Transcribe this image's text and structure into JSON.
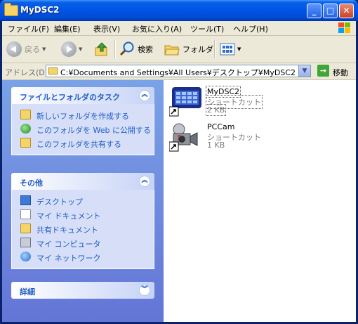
{
  "window": {
    "title": "MyDSC2"
  },
  "menu": [
    "ファイル(F)",
    "編集(E)",
    "表示(V)",
    "お気に入り(A)",
    "ツール(T)",
    "ヘルプ(H)"
  ],
  "toolbar": {
    "back_label": "戻る",
    "search_label": "検索",
    "folders_label": "フォルダ"
  },
  "address": {
    "label": "アドレス(D)",
    "path": "C:¥Documents and Settings¥All Users¥デスクトップ¥MyDSC2",
    "go_label": "移動"
  },
  "tasks_panel": {
    "title": "ファイルとフォルダのタスク",
    "items": [
      {
        "label": "新しいフォルダを作成する",
        "icon": "new-folder-icon"
      },
      {
        "label": "このフォルダを Web に公開する",
        "icon": "publish-web-icon"
      },
      {
        "label": "このフォルダを共有する",
        "icon": "share-folder-icon"
      }
    ]
  },
  "other_panel": {
    "title": "その他",
    "items": [
      {
        "label": "デスクトップ",
        "icon": "desktop-icon"
      },
      {
        "label": "マイ ドキュメント",
        "icon": "my-documents-icon"
      },
      {
        "label": "共有ドキュメント",
        "icon": "shared-documents-icon"
      },
      {
        "label": "マイ コンピュータ",
        "icon": "my-computer-icon"
      },
      {
        "label": "マイ ネットワーク",
        "icon": "my-network-icon"
      }
    ]
  },
  "details_panel": {
    "title": "詳細"
  },
  "files": [
    {
      "name": "MyDSC2",
      "type": "ショートカット",
      "size": "2 KB"
    },
    {
      "name": "PCCam",
      "type": "ショートカット",
      "size": "1 KB"
    }
  ]
}
